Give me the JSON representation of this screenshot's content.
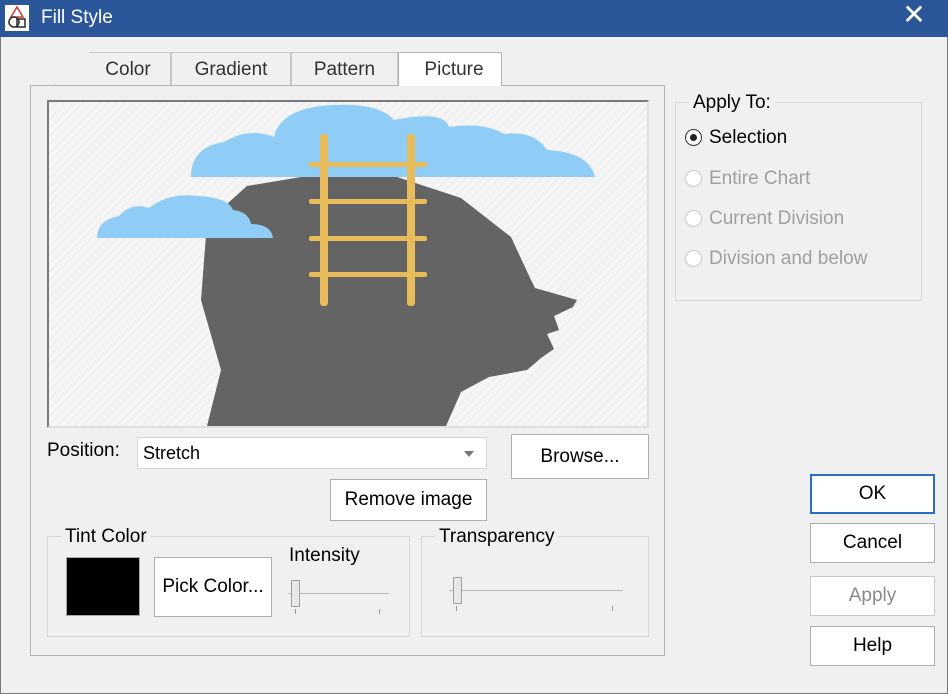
{
  "window": {
    "title": "Fill Style",
    "close_glyph": "✕",
    "app_icon": "fill-style-app-icon"
  },
  "tabs": [
    {
      "label": "Color",
      "active": false
    },
    {
      "label": "Gradient",
      "active": false
    },
    {
      "label": "Pattern",
      "active": false
    },
    {
      "label": "Picture",
      "active": true
    }
  ],
  "picture": {
    "preview_image": "head-with-ladder-and-clouds",
    "position_label": "Position:",
    "position_value": "Stretch",
    "browse_label": "Browse...",
    "remove_label": "Remove image"
  },
  "tint": {
    "group_label": "Tint Color",
    "swatch_color": "#000000",
    "pick_label": "Pick Color...",
    "intensity_label": "Intensity",
    "intensity_value": 0
  },
  "transparency": {
    "group_label": "Transparency",
    "value": 0
  },
  "apply_to": {
    "group_label": "Apply To:",
    "options": [
      {
        "label": "Selection",
        "checked": true,
        "enabled": true
      },
      {
        "label": "Entire Chart",
        "checked": false,
        "enabled": false
      },
      {
        "label": "Current Division",
        "checked": false,
        "enabled": false
      },
      {
        "label": "Division and below",
        "checked": false,
        "enabled": false
      }
    ]
  },
  "buttons": {
    "ok": "OK",
    "cancel": "Cancel",
    "apply": "Apply",
    "help": "Help"
  },
  "colors": {
    "titlebar": "#2b579a",
    "cloud": "#8fcdf7",
    "ladder": "#e8bb5a",
    "head": "#646464"
  }
}
